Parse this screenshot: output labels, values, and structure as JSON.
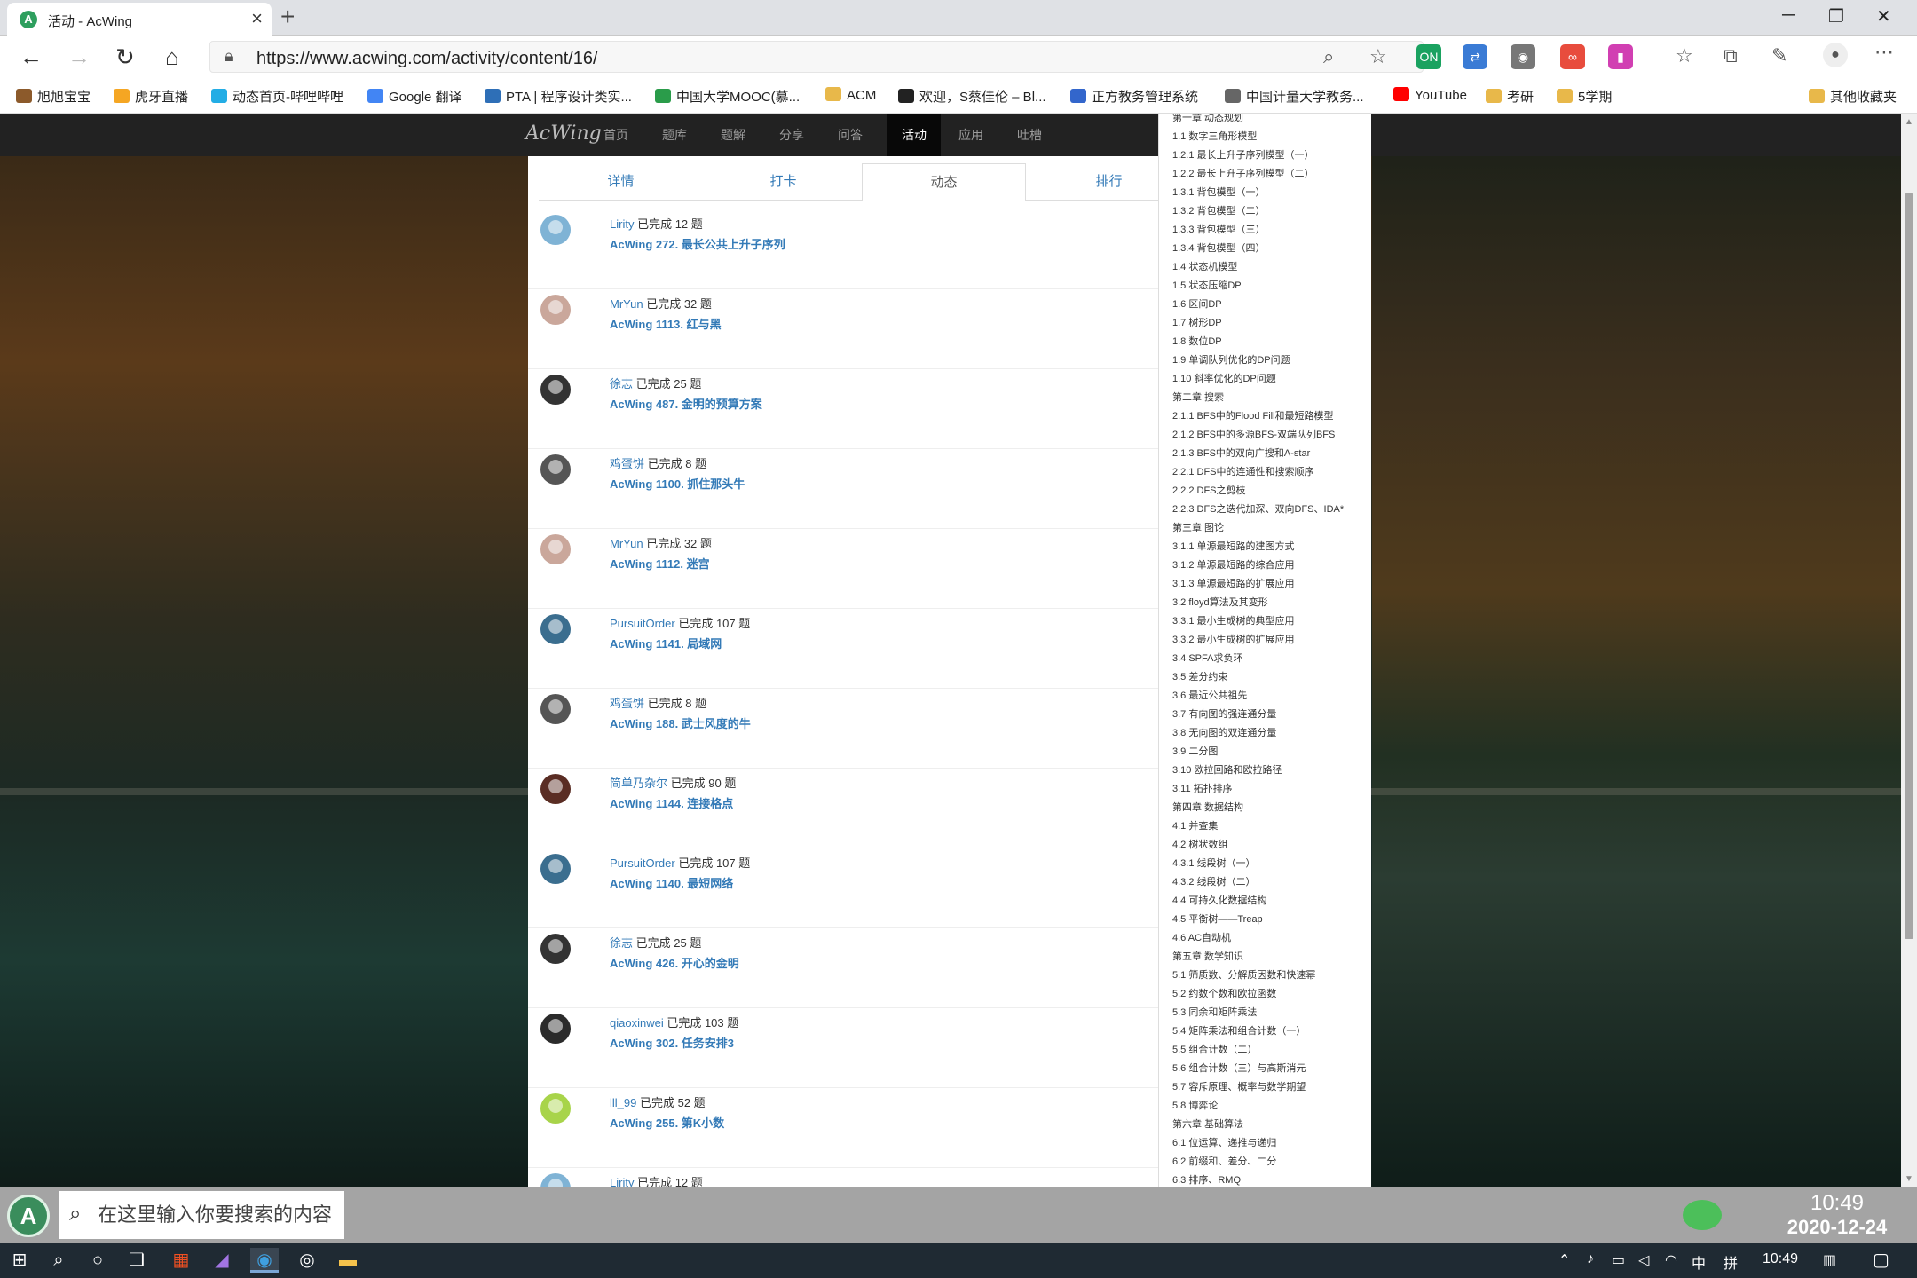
{
  "browser": {
    "tab_title": "活动 - AcWing",
    "tab_favicon": "A",
    "url": "https://www.acwing.com/activity/content/16/",
    "new_tab_symbol": "+",
    "close_symbol": "×",
    "window_buttons": {
      "minimize": "─",
      "restore": "❐",
      "close": "✕"
    },
    "nav": {
      "back": "←",
      "forward": "→",
      "refresh": "↻",
      "home": "⌂"
    },
    "extensions": [
      {
        "name": "ext-translate",
        "label": "ON",
        "color": "#1aa260"
      },
      {
        "name": "ext-sync",
        "label": "⇄",
        "color": "#3a7bd5"
      },
      {
        "name": "ext-record",
        "label": "◉",
        "color": "#777777"
      },
      {
        "name": "ext-infinity",
        "label": "∞",
        "color": "#e84c3d"
      },
      {
        "name": "ext-color",
        "label": "▮",
        "color": "#d13fb2"
      }
    ],
    "bookmarks": [
      {
        "label": "旭旭宝宝",
        "color": "#8c5a2b"
      },
      {
        "label": "虎牙直播",
        "color": "#f5a623"
      },
      {
        "label": "动态首页-哔哩哔哩",
        "color": "#23ade5"
      },
      {
        "label": "Google 翻译",
        "color": "#4285f4"
      },
      {
        "label": "PTA | 程序设计类实...",
        "color": "#2e6fb7"
      },
      {
        "label": "中国大学MOOC(慕...",
        "color": "#2a9c4a"
      },
      {
        "label": "ACM",
        "color": "#e8b84a"
      },
      {
        "label": "欢迎，S蔡佳伦 – Bl...",
        "color": "#222222"
      },
      {
        "label": "正方教务管理系统",
        "color": "#3366cc"
      },
      {
        "label": "中国计量大学教务...",
        "color": "#666666"
      },
      {
        "label": "YouTube",
        "color": "#ff0000"
      },
      {
        "label": "考研",
        "color": "#e8b84a"
      },
      {
        "label": "5学期",
        "color": "#e8b84a"
      },
      {
        "label": "其他收藏夹",
        "color": "#e8b84a"
      }
    ]
  },
  "site": {
    "logo": "AcWing",
    "nav": [
      "首页",
      "题库",
      "题解",
      "分享",
      "问答",
      "活动",
      "应用",
      "吐槽"
    ],
    "active_nav": "活动"
  },
  "tabs": [
    "详情",
    "打卡",
    "动态",
    "排行"
  ],
  "active_tab": "动态",
  "feed": [
    {
      "user": "Lirity",
      "status": "已完成 12 题",
      "problem": "AcWing 272. 最长公共上升子序列",
      "avatar_color": "#7fb3d5"
    },
    {
      "user": "MrYun",
      "status": "已完成 32 题",
      "problem": "AcWing 1113. 红与黑",
      "avatar_color": "#caa79b"
    },
    {
      "user": "徐志",
      "status": "已完成 25 题",
      "problem": "AcWing 487. 金明的预算方案",
      "avatar_color": "#333333"
    },
    {
      "user": "鸡蛋饼",
      "status": "已完成 8 题",
      "problem": "AcWing 1100. 抓住那头牛",
      "avatar_color": "#555555"
    },
    {
      "user": "MrYun",
      "status": "已完成 32 题",
      "problem": "AcWing 1112. 迷宫",
      "avatar_color": "#caa79b"
    },
    {
      "user": "PursuitOrder",
      "status": "已完成 107 题",
      "problem": "AcWing 1141. 局域网",
      "avatar_color": "#3b6e8f"
    },
    {
      "user": "鸡蛋饼",
      "status": "已完成 8 题",
      "problem": "AcWing 188. 武士风度的牛",
      "avatar_color": "#555555"
    },
    {
      "user": "简单乃杂尔",
      "status": "已完成 90 题",
      "problem": "AcWing 1144. 连接格点",
      "avatar_color": "#5a2d24"
    },
    {
      "user": "PursuitOrder",
      "status": "已完成 107 题",
      "problem": "AcWing 1140. 最短网络",
      "avatar_color": "#3b6e8f"
    },
    {
      "user": "徐志",
      "status": "已完成 25 题",
      "problem": "AcWing 426. 开心的金明",
      "avatar_color": "#333333"
    },
    {
      "user": "qiaoxinwei",
      "status": "已完成 103 题",
      "problem": "AcWing 302. 任务安排3",
      "avatar_color": "#2b2b2b"
    },
    {
      "user": "lll_99",
      "status": "已完成 52 题",
      "problem": "AcWing 255. 第K小数",
      "avatar_color": "#a8d44a"
    },
    {
      "user": "Lirity",
      "status": "已完成 12 题",
      "problem": "",
      "avatar_color": "#7fb3d5"
    }
  ],
  "toc": [
    "第一章 动态规划",
    "1.1 数字三角形模型",
    "1.2.1 最长上升子序列模型（一）",
    "1.2.2 最长上升子序列模型（二）",
    "1.3.1 背包模型（一）",
    "1.3.2 背包模型（二）",
    "1.3.3 背包模型（三）",
    "1.3.4 背包模型（四）",
    "1.4 状态机模型",
    "1.5 状态压缩DP",
    "1.6 区间DP",
    "1.7 树形DP",
    "1.8 数位DP",
    "1.9 单调队列优化的DP问题",
    "1.10 斜率优化的DP问题",
    "第二章 搜索",
    "2.1.1 BFS中的Flood Fill和最短路模型",
    "2.1.2 BFS中的多源BFS-双端队列BFS",
    "2.1.3 BFS中的双向广搜和A-star",
    "2.2.1 DFS中的连通性和搜索顺序",
    "2.2.2 DFS之剪枝",
    "2.2.3 DFS之迭代加深、双向DFS、IDA*",
    "第三章 图论",
    "3.1.1 单源最短路的建图方式",
    "3.1.2 单源最短路的综合应用",
    "3.1.3 单源最短路的扩展应用",
    "3.2 floyd算法及其变形",
    "3.3.1 最小生成树的典型应用",
    "3.3.2 最小生成树的扩展应用",
    "3.4 SPFA求负环",
    "3.5 差分约束",
    "3.6 最近公共祖先",
    "3.7 有向图的强连通分量",
    "3.8 无向图的双连通分量",
    "3.9 二分图",
    "3.10 欧拉回路和欧拉路径",
    "3.11 拓扑排序",
    "第四章 数据结构",
    "4.1 并查集",
    "4.2 树状数组",
    "4.3.1 线段树（一）",
    "4.3.2 线段树（二）",
    "4.4 可持久化数据结构",
    "4.5 平衡树——Treap",
    "4.6 AC自动机",
    "第五章 数学知识",
    "5.1 筛质数、分解质因数和快速幂",
    "5.2 约数个数和欧拉函数",
    "5.3 同余和矩阵乘法",
    "5.4 矩阵乘法和组合计数（一）",
    "5.5 组合计数（二）",
    "5.6 组合计数（三）与高斯消元",
    "5.7 容斥原理、概率与数学期望",
    "5.8 博弈论",
    "第六章 基础算法",
    "6.1 位运算、递推与递归",
    "6.2 前缀和、差分、二分",
    "6.3 排序、RMQ"
  ],
  "overlay": {
    "search_placeholder": "在这里输入你要搜索的内容",
    "time": "10:49",
    "date": "2020-12-24"
  },
  "taskbar": {
    "clock": "10:49",
    "ime": "中",
    "ime_mode": "拼"
  }
}
